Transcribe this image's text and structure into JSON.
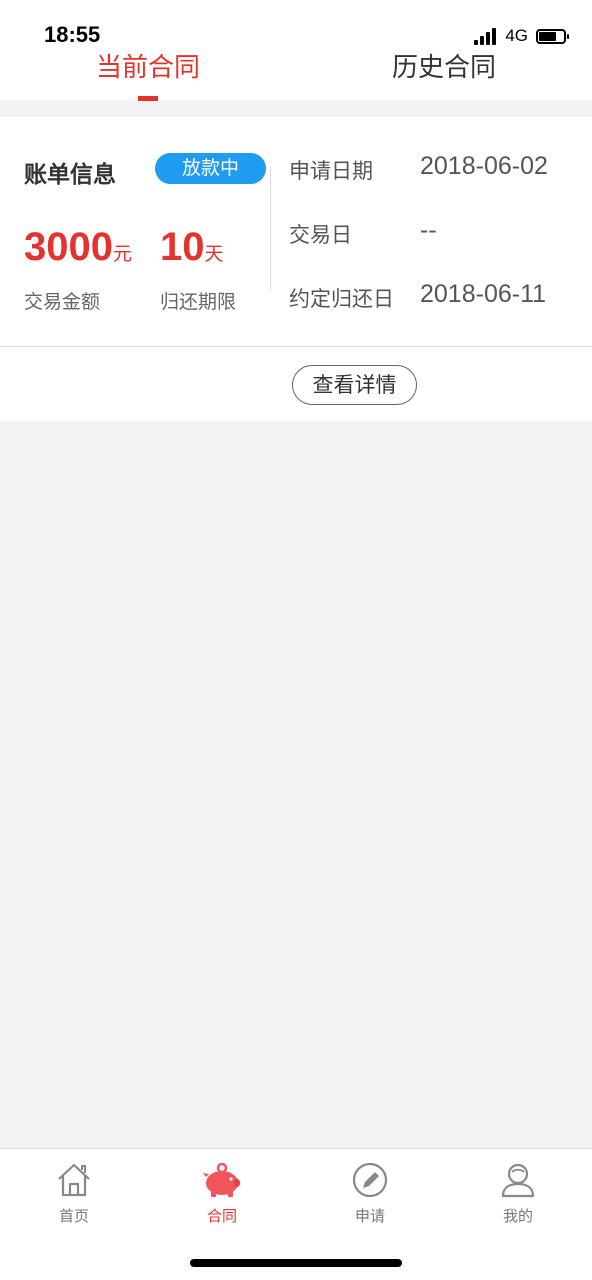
{
  "status_bar": {
    "time": "18:55",
    "network": "4G"
  },
  "tabs": [
    {
      "label": "当前合同",
      "active": true
    },
    {
      "label": "历史合同",
      "active": false
    }
  ],
  "bill": {
    "title": "账单信息",
    "status": "放款中",
    "amount_value": "3000",
    "amount_unit": "元",
    "amount_label": "交易金额",
    "term_value": "10",
    "term_unit": "天",
    "term_label": "归还期限",
    "fields": [
      {
        "label": "申请日期",
        "value": "2018-06-02"
      },
      {
        "label": "交易日",
        "value": "--"
      },
      {
        "label": "约定归还日",
        "value": "2018-06-11"
      }
    ],
    "detail_button": "查看详情"
  },
  "nav": [
    {
      "label": "首页",
      "icon": "home-icon",
      "active": false
    },
    {
      "label": "合同",
      "icon": "piggy-bank-icon",
      "active": true
    },
    {
      "label": "申请",
      "icon": "pencil-icon",
      "active": false
    },
    {
      "label": "我的",
      "icon": "user-icon",
      "active": false
    }
  ],
  "colors": {
    "accent": "#e5322d",
    "badge": "#1f9bf0",
    "background": "#f2f2f2"
  }
}
